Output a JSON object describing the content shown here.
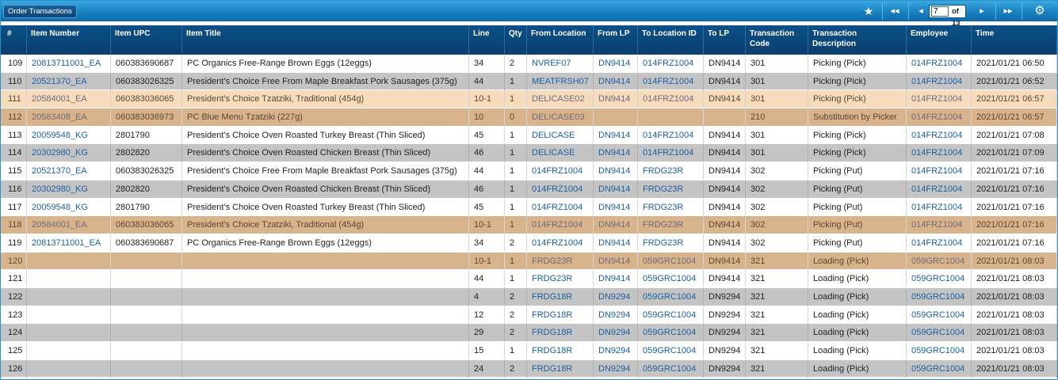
{
  "window": {
    "title": "Order Transactions"
  },
  "pager": {
    "current_page": "7",
    "of_label": "of 13",
    "icons": {
      "favorite": "star-icon",
      "first": "first-page-icon",
      "prev": "prev-page-icon",
      "next": "next-page-icon",
      "last": "last-page-icon",
      "settings": "gear-icon"
    },
    "glyphs": {
      "favorite": "★",
      "first": "◂◂",
      "prev": "◂",
      "next": "▸",
      "last": "▸▸",
      "settings": "⚙"
    }
  },
  "table": {
    "columns": [
      "#",
      "Item Number",
      "Item UPC",
      "Item Title",
      "Line",
      "Qty",
      "From Location",
      "From LP",
      "To Location ID",
      "To LP",
      "Transaction Code",
      "Transaction Description",
      "Employee",
      "Time"
    ],
    "rows": [
      {
        "n": "109",
        "item": "20813711001_EA",
        "upc": "060383690687",
        "title": "PC Organics Free-Range Brown Eggs (12eggs)",
        "line": "34",
        "qty": "2",
        "from": "NVREF07",
        "from_lp": "DN9414",
        "to_loc": "014FRZ1004",
        "to_lp": "DN9414",
        "code": "301",
        "desc": "Picking (Pick)",
        "emp": "014FRZ1004",
        "time": "2021/01/21 06:50",
        "style": "white"
      },
      {
        "n": "110",
        "item": "20521370_EA",
        "upc": "060383026325",
        "title": "President's Choice Free From Maple Breakfast Pork Sausages (375g)",
        "line": "44",
        "qty": "1",
        "from": "MEATFRSH07",
        "from_lp": "DN9414",
        "to_loc": "014FRZ1004",
        "to_lp": "DN9414",
        "code": "301",
        "desc": "Picking (Pick)",
        "emp": "014FRZ1004",
        "time": "2021/01/21 06:52",
        "style": "gray"
      },
      {
        "n": "111",
        "item": "20584001_EA",
        "upc": "060383036065",
        "title": "President's Choice Tzatziki, Traditional (454g)",
        "line": "10-1",
        "qty": "1",
        "from": "DELICASE02",
        "from_lp": "DN9414",
        "to_loc": "014FRZ1004",
        "to_lp": "DN9414",
        "code": "301",
        "desc": "Picking (Pick)",
        "emp": "014FRZ1004",
        "time": "2021/01/21 06:57",
        "style": "peach"
      },
      {
        "n": "112",
        "item": "20583408_EA",
        "upc": "060383036973",
        "title": "PC Blue Menu Tzatziki (227g)",
        "line": "10",
        "qty": "0",
        "from": "DELICASE03",
        "from_lp": "",
        "to_loc": "",
        "to_lp": "",
        "code": "210",
        "desc": "Substitution by Picker",
        "emp": "014FRZ1004",
        "time": "2021/01/21 06:57",
        "style": "tan"
      },
      {
        "n": "113",
        "item": "20059548_KG",
        "upc": "2801790",
        "title": "President's Choice Oven Roasted Turkey Breast (Thin Sliced)",
        "line": "45",
        "qty": "1",
        "from": "DELICASE",
        "from_lp": "DN9414",
        "to_loc": "014FRZ1004",
        "to_lp": "DN9414",
        "code": "301",
        "desc": "Picking (Pick)",
        "emp": "014FRZ1004",
        "time": "2021/01/21 07:08",
        "style": "white"
      },
      {
        "n": "114",
        "item": "20302980_KG",
        "upc": "2802820",
        "title": "President's Choice Oven Roasted Chicken Breast (Thin Sliced)",
        "line": "46",
        "qty": "1",
        "from": "DELICASE",
        "from_lp": "DN9414",
        "to_loc": "014FRZ1004",
        "to_lp": "DN9414",
        "code": "301",
        "desc": "Picking (Pick)",
        "emp": "014FRZ1004",
        "time": "2021/01/21 07:09",
        "style": "gray"
      },
      {
        "n": "115",
        "item": "20521370_EA",
        "upc": "060383026325",
        "title": "President's Choice Free From Maple Breakfast Pork Sausages (375g)",
        "line": "44",
        "qty": "1",
        "from": "014FRZ1004",
        "from_lp": "DN9414",
        "to_loc": "FRDG23R",
        "to_lp": "DN9414",
        "code": "302",
        "desc": "Picking (Put)",
        "emp": "014FRZ1004",
        "time": "2021/01/21 07:16",
        "style": "white"
      },
      {
        "n": "116",
        "item": "20302980_KG",
        "upc": "2802820",
        "title": "President's Choice Oven Roasted Chicken Breast (Thin Sliced)",
        "line": "46",
        "qty": "1",
        "from": "014FRZ1004",
        "from_lp": "DN9414",
        "to_loc": "FRDG23R",
        "to_lp": "DN9414",
        "code": "302",
        "desc": "Picking (Put)",
        "emp": "014FRZ1004",
        "time": "2021/01/21 07:16",
        "style": "gray"
      },
      {
        "n": "117",
        "item": "20059548_KG",
        "upc": "2801790",
        "title": "President's Choice Oven Roasted Turkey Breast (Thin Sliced)",
        "line": "45",
        "qty": "1",
        "from": "014FRZ1004",
        "from_lp": "DN9414",
        "to_loc": "FRDG23R",
        "to_lp": "DN9414",
        "code": "302",
        "desc": "Picking (Put)",
        "emp": "014FRZ1004",
        "time": "2021/01/21 07:16",
        "style": "white"
      },
      {
        "n": "118",
        "item": "20584001_EA",
        "upc": "060383036065",
        "title": "President's Choice Tzatziki, Traditional (454g)",
        "line": "10-1",
        "qty": "1",
        "from": "014FRZ1004",
        "from_lp": "DN9414",
        "to_loc": "FRDG23R",
        "to_lp": "DN9414",
        "code": "302",
        "desc": "Picking (Put)",
        "emp": "014FRZ1004",
        "time": "2021/01/21 07:16",
        "style": "tan"
      },
      {
        "n": "119",
        "item": "20813711001_EA",
        "upc": "060383690687",
        "title": "PC Organics Free-Range Brown Eggs (12eggs)",
        "line": "34",
        "qty": "2",
        "from": "014FRZ1004",
        "from_lp": "DN9414",
        "to_loc": "FRDG23R",
        "to_lp": "DN9414",
        "code": "302",
        "desc": "Picking (Put)",
        "emp": "014FRZ1004",
        "time": "2021/01/21 07:16",
        "style": "white"
      },
      {
        "n": "120",
        "item": "",
        "upc": "",
        "title": "",
        "line": "10-1",
        "qty": "1",
        "from": "FRDG23R",
        "from_lp": "DN9414",
        "to_loc": "059GRC1004",
        "to_lp": "DN9414",
        "code": "321",
        "desc": "Loading (Pick)",
        "emp": "059GRC1004",
        "time": "2021/01/21 08:03",
        "style": "tan"
      },
      {
        "n": "121",
        "item": "",
        "upc": "",
        "title": "",
        "line": "44",
        "qty": "1",
        "from": "FRDG23R",
        "from_lp": "DN9414",
        "to_loc": "059GRC1004",
        "to_lp": "DN9414",
        "code": "321",
        "desc": "Loading (Pick)",
        "emp": "059GRC1004",
        "time": "2021/01/21 08:03",
        "style": "white"
      },
      {
        "n": "122",
        "item": "",
        "upc": "",
        "title": "",
        "line": "4",
        "qty": "2",
        "from": "FRDG18R",
        "from_lp": "DN9294",
        "to_loc": "059GRC1004",
        "to_lp": "DN9294",
        "code": "321",
        "desc": "Loading (Pick)",
        "emp": "059GRC1004",
        "time": "2021/01/21 08:03",
        "style": "gray"
      },
      {
        "n": "123",
        "item": "",
        "upc": "",
        "title": "",
        "line": "12",
        "qty": "2",
        "from": "FRDG18R",
        "from_lp": "DN9294",
        "to_loc": "059GRC1004",
        "to_lp": "DN9294",
        "code": "321",
        "desc": "Loading (Pick)",
        "emp": "059GRC1004",
        "time": "2021/01/21 08:03",
        "style": "white"
      },
      {
        "n": "124",
        "item": "",
        "upc": "",
        "title": "",
        "line": "29",
        "qty": "2",
        "from": "FRDG18R",
        "from_lp": "DN9294",
        "to_loc": "059GRC1004",
        "to_lp": "DN9294",
        "code": "321",
        "desc": "Loading (Pick)",
        "emp": "059GRC1004",
        "time": "2021/01/21 08:03",
        "style": "gray"
      },
      {
        "n": "125",
        "item": "",
        "upc": "",
        "title": "",
        "line": "15",
        "qty": "1",
        "from": "FRDG18R",
        "from_lp": "DN9294",
        "to_loc": "059GRC1004",
        "to_lp": "DN9294",
        "code": "321",
        "desc": "Loading (Pick)",
        "emp": "059GRC1004",
        "time": "2021/01/21 08:03",
        "style": "white"
      },
      {
        "n": "126",
        "item": "",
        "upc": "",
        "title": "",
        "line": "24",
        "qty": "2",
        "from": "FRDG18R",
        "from_lp": "DN9294",
        "to_loc": "059GRC1004",
        "to_lp": "DN9294",
        "code": "321",
        "desc": "Loading (Pick)",
        "emp": "059GRC1004",
        "time": "2021/01/21 08:03",
        "style": "gray"
      }
    ]
  },
  "colors": {
    "accent": "#1e86c6",
    "header": "#0c4f86",
    "link": "#1d5fa0",
    "row_gray": "#c4c4c4",
    "row_peach": "#f6dcbc",
    "row_tan": "#d8b48c"
  }
}
